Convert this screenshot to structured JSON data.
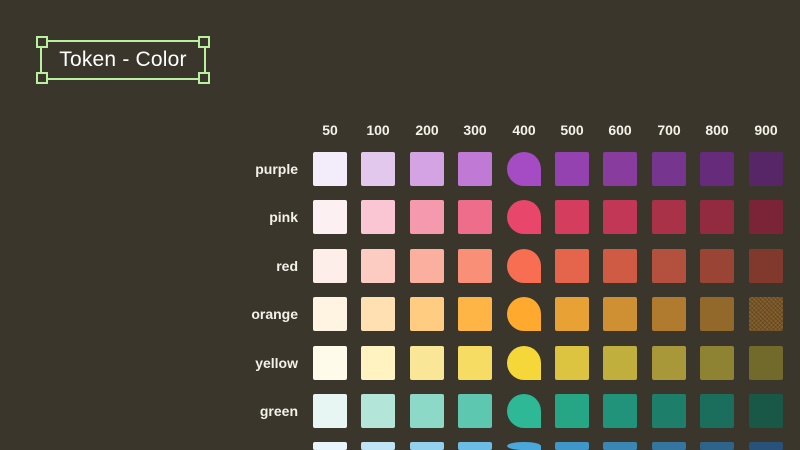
{
  "frame": {
    "title": "Token - Color"
  },
  "columns": [
    "50",
    "100",
    "200",
    "300",
    "400",
    "500",
    "600",
    "700",
    "800",
    "900"
  ],
  "rows": [
    {
      "name": "purple",
      "colors": [
        "#f3ecfb",
        "#e2c8ec",
        "#d3a3e3",
        "#c07ad6",
        "#a54bc4",
        "#9542b1",
        "#873c9e",
        "#76358f",
        "#662c7b",
        "#572666"
      ]
    },
    {
      "name": "pink",
      "colors": [
        "#fdf0f3",
        "#fac6d3",
        "#f59aae",
        "#ee6d8a",
        "#e8466a",
        "#d53d5f",
        "#c23756",
        "#a93249",
        "#922b3f",
        "#7c2437"
      ]
    },
    {
      "name": "red",
      "colors": [
        "#fdeeea",
        "#fcccc2",
        "#fbaf9e",
        "#fa8f78",
        "#f76e52",
        "#e5644c",
        "#cf5b45",
        "#b4503e",
        "#9a4435",
        "#82392d"
      ]
    },
    {
      "name": "orange",
      "colors": [
        "#fff3e2",
        "#ffe0b3",
        "#ffcc82",
        "#ffb446",
        "#ffa92e",
        "#e8a134",
        "#cf8f33",
        "#b17b2f",
        "#93682b",
        "#7a5625"
      ]
    },
    {
      "name": "yellow",
      "colors": [
        "#fffbeb",
        "#fff3c2",
        "#f9e797",
        "#f7dc63",
        "#f5d73a",
        "#dcc441",
        "#c1af3d",
        "#a8983a",
        "#8e8233",
        "#726a2a"
      ]
    },
    {
      "name": "green",
      "colors": [
        "#e7f6f3",
        "#b3e6d9",
        "#8cd9c8",
        "#5ec7b0",
        "#2eb896",
        "#27a686",
        "#21937a",
        "#1d7f6a",
        "#1b6d5c",
        "#195847"
      ]
    },
    {
      "name": "",
      "colors": [
        "#e8f5fc",
        "#bfe4f5",
        "#93d1ef",
        "#6bbde5",
        "#4aa9dc",
        "#3f96c8",
        "#3a86b4",
        "#34769f",
        "#2e648a",
        "#28527a"
      ]
    }
  ]
}
